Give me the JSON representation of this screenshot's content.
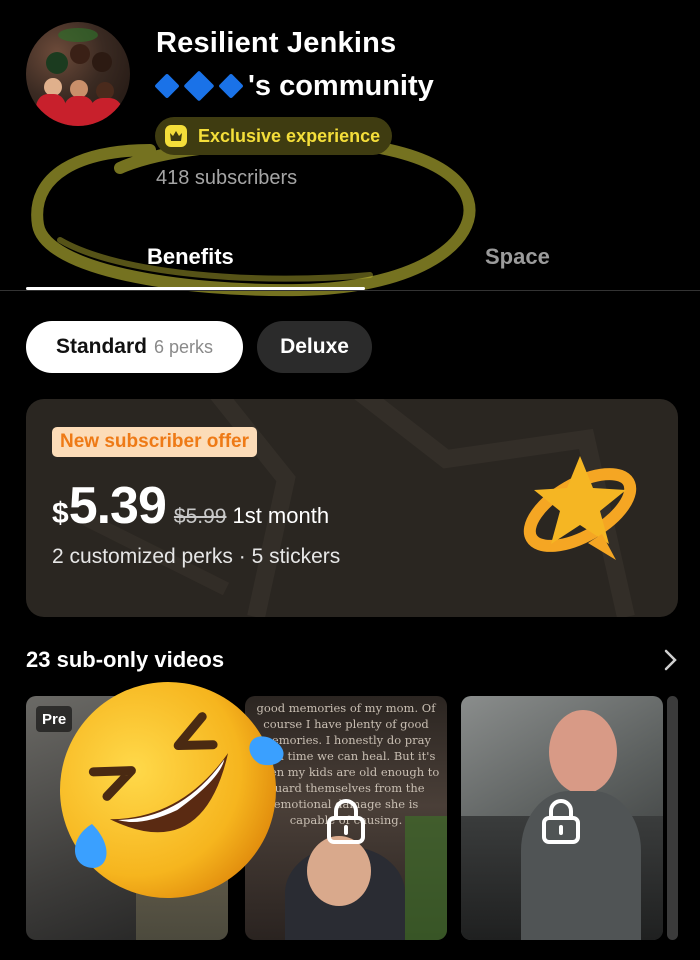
{
  "profile": {
    "name": "Resilient Jenkins",
    "community_suffix": "'s community",
    "exclusive_label": "Exclusive experience",
    "subscribers": "418 subscribers"
  },
  "tabs": [
    {
      "label": "Benefits",
      "active": true
    },
    {
      "label": "Space",
      "active": false
    }
  ],
  "tiers": {
    "standard_label": "Standard",
    "standard_perks": "6 perks",
    "deluxe_label": "Deluxe"
  },
  "offer": {
    "badge": "New subscriber offer",
    "currency": "$",
    "price": "5.39",
    "old_price": "$5.99",
    "period": "1st month",
    "perks_summary": "2 customized perks · 5 stickers"
  },
  "videos": {
    "title": "23 sub-only videos",
    "preview_badge": "Pre",
    "thumb2_text": "good memories of my mom. Of course I have plenty of good memories. I honestly do pray for a time we can heal. But it's when my kids are old enough to guard themselves from the emotional damage she is capable of causing."
  },
  "colors": {
    "accent_yellow": "#f4de3a",
    "offer_orange": "#ee7a16",
    "card_bg": "#2a2621",
    "diamond_blue": "#1a72e8"
  },
  "icons": [
    "crown-icon",
    "diamond-icon",
    "star-logo-icon",
    "chevron-right-icon",
    "lock-icon",
    "rofl-emoji-sticker"
  ]
}
